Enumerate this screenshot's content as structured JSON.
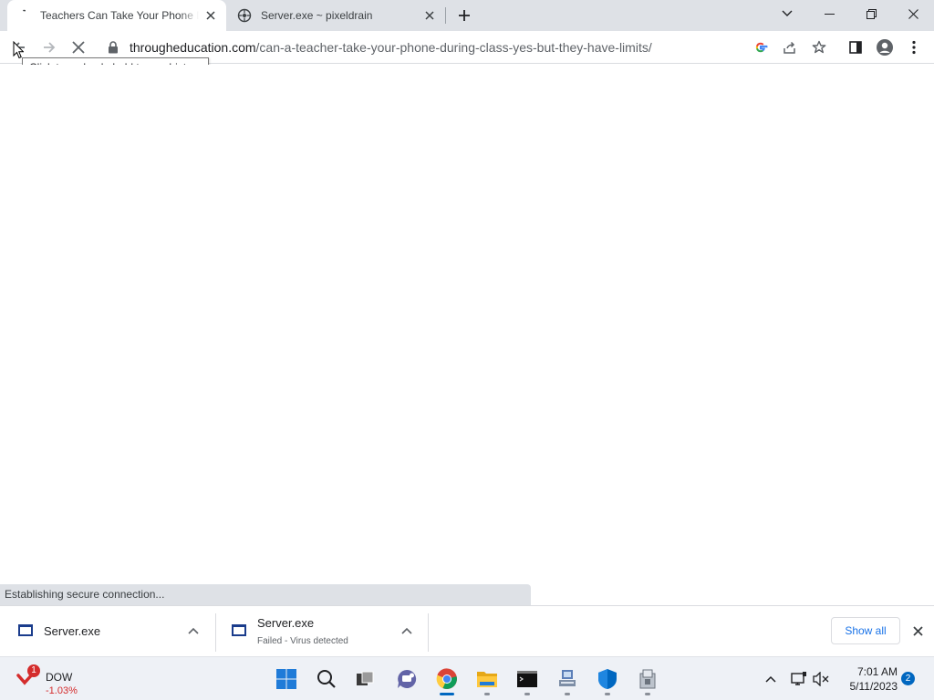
{
  "browser": {
    "tabs": [
      {
        "title": "Teachers Can Take Your Phone During Class",
        "favicon": "loading-spinner-icon",
        "active": true
      },
      {
        "title": "Server.exe ~ pixeldrain",
        "favicon": "pixeldrain-icon",
        "active": false
      }
    ],
    "address_bar": {
      "domain": "througheducation.com",
      "path": "/can-a-teacher-take-your-phone-during-class-yes-but-they-have-limits/"
    },
    "back_tooltip": "Click to go back, hold to see history",
    "status_text": "Establishing secure connection..."
  },
  "downloads": {
    "items": [
      {
        "filename": "Server.exe",
        "status": ""
      },
      {
        "filename": "Server.exe",
        "status": "Failed - Virus detected"
      }
    ],
    "show_all_label": "Show all"
  },
  "taskbar": {
    "widget": {
      "badge": "1",
      "ticker": "DOW",
      "change": "-1.03%"
    },
    "clock": {
      "time": "7:01 AM",
      "date": "5/11/2023"
    },
    "notification_count": "2"
  },
  "colors": {
    "accent": "#1a73e8",
    "tab_strip": "#dee1e6",
    "negative": "#d42c2c",
    "windows_blue": "#0067c0"
  }
}
